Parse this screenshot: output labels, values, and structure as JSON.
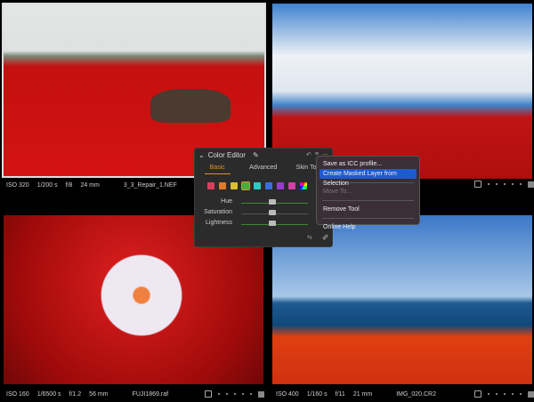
{
  "photos": [
    {
      "iso": "ISO 320",
      "shutter": "1/200 s",
      "aperture": "f/8",
      "focal": "24 mm",
      "filename": "3_3_Repair_1.NEF"
    },
    {
      "iso": "",
      "shutter": "",
      "aperture": "",
      "focal": "",
      "filename": ""
    },
    {
      "iso": "ISO 160",
      "shutter": "1/6500 s",
      "aperture": "f/1.2",
      "focal": "56 mm",
      "filename": "FUJI1869.raf"
    },
    {
      "iso": "ISO 400",
      "shutter": "1/160 s",
      "aperture": "f/11",
      "focal": "21 mm",
      "filename": "IMG_020.CR2"
    }
  ],
  "color_editor": {
    "title": "Color Editor",
    "tabs": [
      "Basic",
      "Advanced",
      "Skin Tone"
    ],
    "active_tab": "Basic",
    "swatches": [
      "#d8405a",
      "#e07a2a",
      "#d8c030",
      "#40b040",
      "#30c8c0",
      "#3a6ee0",
      "#9a3ad0",
      "#d040a8"
    ],
    "sliders": [
      {
        "label": "Hue",
        "value": 0
      },
      {
        "label": "Saturation",
        "value": 0
      },
      {
        "label": "Lightness",
        "value": 0
      }
    ]
  },
  "context_menu": {
    "items": [
      "Save as ICC profile...",
      "Create Masked Layer from Selection",
      "Move To...",
      "Remove Tool",
      "Online Help"
    ],
    "highlighted": "Create Masked Layer from Selection"
  }
}
